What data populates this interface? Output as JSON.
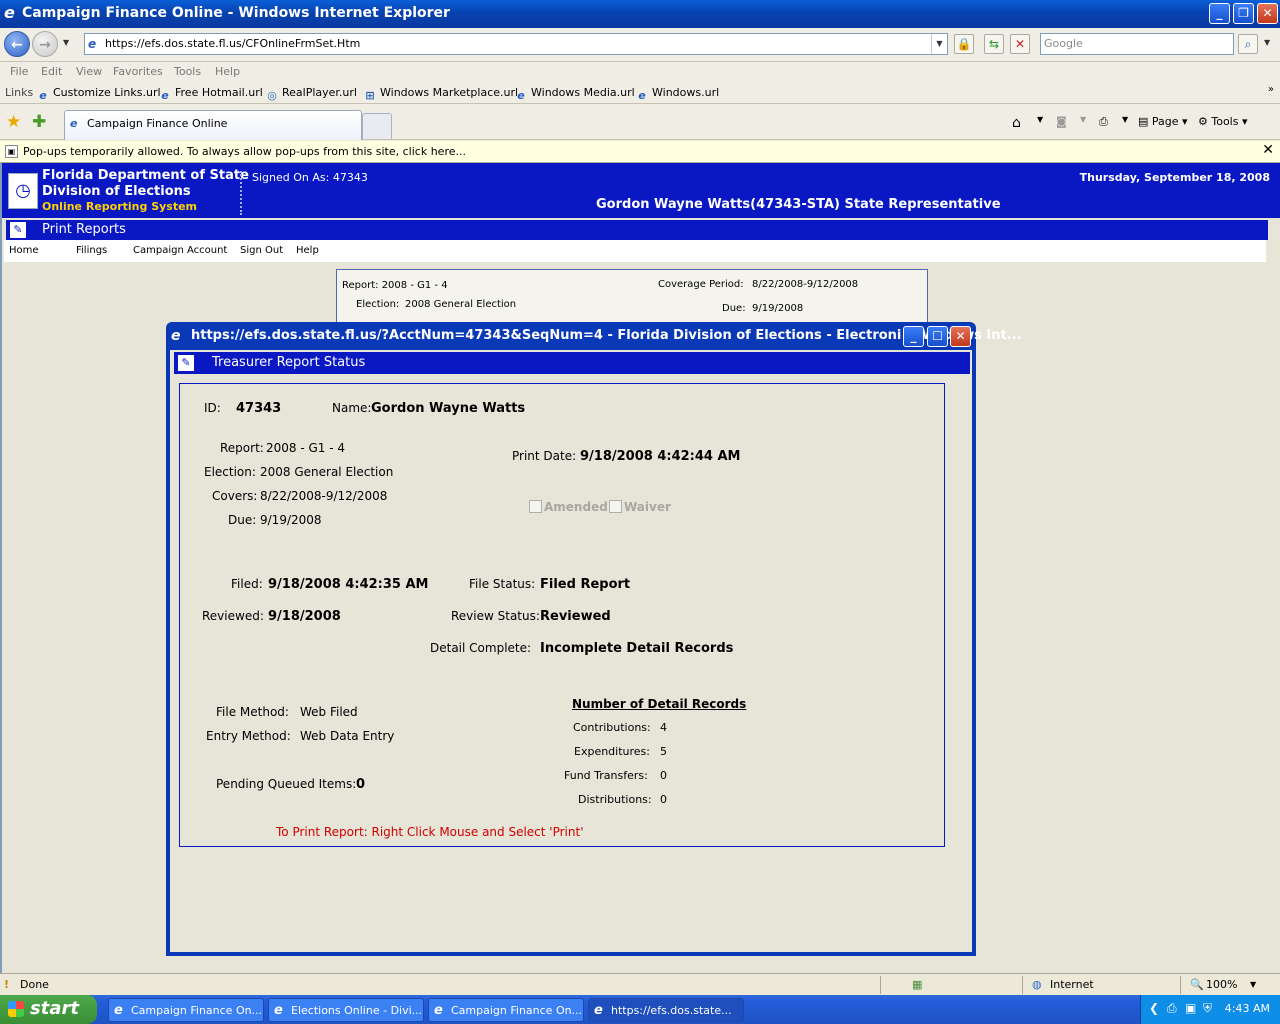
{
  "window": {
    "title": "Campaign Finance Online - Windows Internet Explorer"
  },
  "address": {
    "url": "https://efs.dos.state.fl.us/CFOnlineFrmSet.Htm"
  },
  "search": {
    "placeholder": "Google"
  },
  "menu": [
    "File",
    "Edit",
    "View",
    "Favorites",
    "Tools",
    "Help"
  ],
  "links": {
    "label": "Links",
    "items": [
      "Customize Links.url",
      "Free Hotmail.url",
      "RealPlayer.url",
      "Windows Marketplace.url",
      "Windows Media.url",
      "Windows.url"
    ]
  },
  "tab": {
    "label": "Campaign Finance Online"
  },
  "commandbar": {
    "page": "Page",
    "tools": "Tools"
  },
  "popupbar": {
    "text": "Pop-ups temporarily allowed. To always allow pop-ups from this site, click here..."
  },
  "site": {
    "org_line1": "Florida Department of State",
    "org_line2": "Division of Elections",
    "org_line3": "Online Reporting System",
    "signed_on": "Signed On As: 47343",
    "date": "Thursday, September 18, 2008",
    "candidate": "Gordon Wayne Watts(47343-STA) State Representative",
    "section_title": "Print Reports",
    "nav": [
      "Home",
      "Filings",
      "Campaign Account",
      "Sign Out",
      "Help"
    ]
  },
  "background_report": {
    "report": "Report: 2008 - G1 - 4",
    "election_label": "Election:",
    "election": "2008 General Election",
    "coverage_label": "Coverage Period:",
    "coverage": "8/22/2008-9/12/2008",
    "due_label": "Due:",
    "due": "9/19/2008"
  },
  "popup": {
    "title": "https://efs.dos.state.fl.us/?AcctNum=47343&SeqNum=4 - Florida Division of Elections - Electroni - Windows Int...",
    "header": "Treasurer Report Status",
    "id_label": "ID:",
    "id": "47343",
    "name_label": "Name:",
    "name": "Gordon Wayne Watts",
    "report_label": "Report:",
    "report": "2008 - G1 - 4",
    "election_label": "Election:",
    "election": "2008 General Election",
    "covers_label": "Covers:",
    "covers": "8/22/2008-9/12/2008",
    "due_label": "Due:",
    "due": "9/19/2008",
    "print_date_label": "Print Date:",
    "print_date": "9/18/2008 4:42:44 AM",
    "amended_label": "Amended",
    "waiver_label": "Waiver",
    "filed_label": "Filed:",
    "filed": "9/18/2008 4:42:35 AM",
    "file_status_label": "File Status:",
    "file_status": "Filed Report",
    "reviewed_label": "Reviewed:",
    "reviewed": "9/18/2008",
    "review_status_label": "Review Status:",
    "review_status": "Reviewed",
    "detail_complete_label": "Detail Complete:",
    "detail_complete": "Incomplete Detail Records",
    "file_method_label": "File Method:",
    "file_method": "Web Filed",
    "entry_method_label": "Entry Method:",
    "entry_method": "Web Data Entry",
    "pending_label": "Pending Queued Items:",
    "pending": "0",
    "detail_records_title": "Number of Detail Records",
    "contributions_label": "Contributions:",
    "contributions": "4",
    "expenditures_label": "Expenditures:",
    "expenditures": "5",
    "fund_transfers_label": "Fund Transfers:",
    "fund_transfers": "0",
    "distributions_label": "Distributions:",
    "distributions": "0",
    "print_hint": "To Print Report: Right Click Mouse and Select 'Print'"
  },
  "statusbar": {
    "status": "Done",
    "zone": "Internet",
    "zoom": "100%"
  },
  "taskbar": {
    "start": "start",
    "tasks": [
      "Campaign Finance On...",
      "Elections Online - Divi...",
      "Campaign Finance On...",
      "https://efs.dos.state..."
    ],
    "clock": "4:43 AM"
  }
}
